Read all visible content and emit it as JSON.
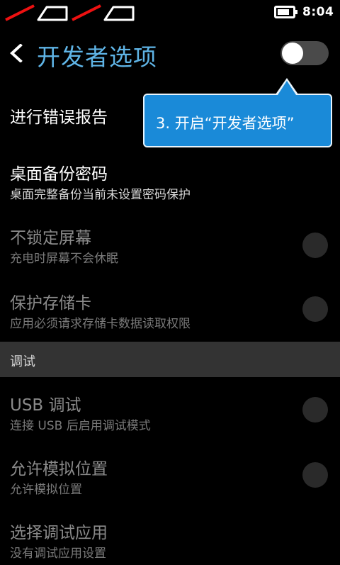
{
  "status_bar": {
    "time": "8:04",
    "battery_level": 0.8,
    "signal_icons": [
      "no-signal-icon-1",
      "no-signal-icon-2"
    ],
    "battery_icon": "battery-icon"
  },
  "header": {
    "title": "开发者选项",
    "back_icon": "back-arrow-icon",
    "toggle_on": false,
    "title_color": "#5fb4e6"
  },
  "callout": {
    "text": "3. 开启“开发者选项”",
    "color": "#1a8ad8"
  },
  "rows": [
    {
      "title": "进行错误报告",
      "subtitle": ""
    },
    {
      "title": "桌面备份密码",
      "subtitle": "桌面完整备份当前未设置密码保护"
    },
    {
      "title": "不锁定屏幕",
      "subtitle": "充电时屏幕不会休眠",
      "checked": false
    },
    {
      "title": "保护存储卡",
      "subtitle": "应用必须请求存储卡数据读取权限",
      "checked": false
    },
    {
      "title": "USB 调试",
      "subtitle": "连接 USB 后启用调试模式",
      "checked": false
    },
    {
      "title": "允许模拟位置",
      "subtitle": "允许模拟位置",
      "checked": false
    },
    {
      "title": "选择调试应用",
      "subtitle": "没有调试应用设置"
    }
  ],
  "section": {
    "label": "调试"
  }
}
